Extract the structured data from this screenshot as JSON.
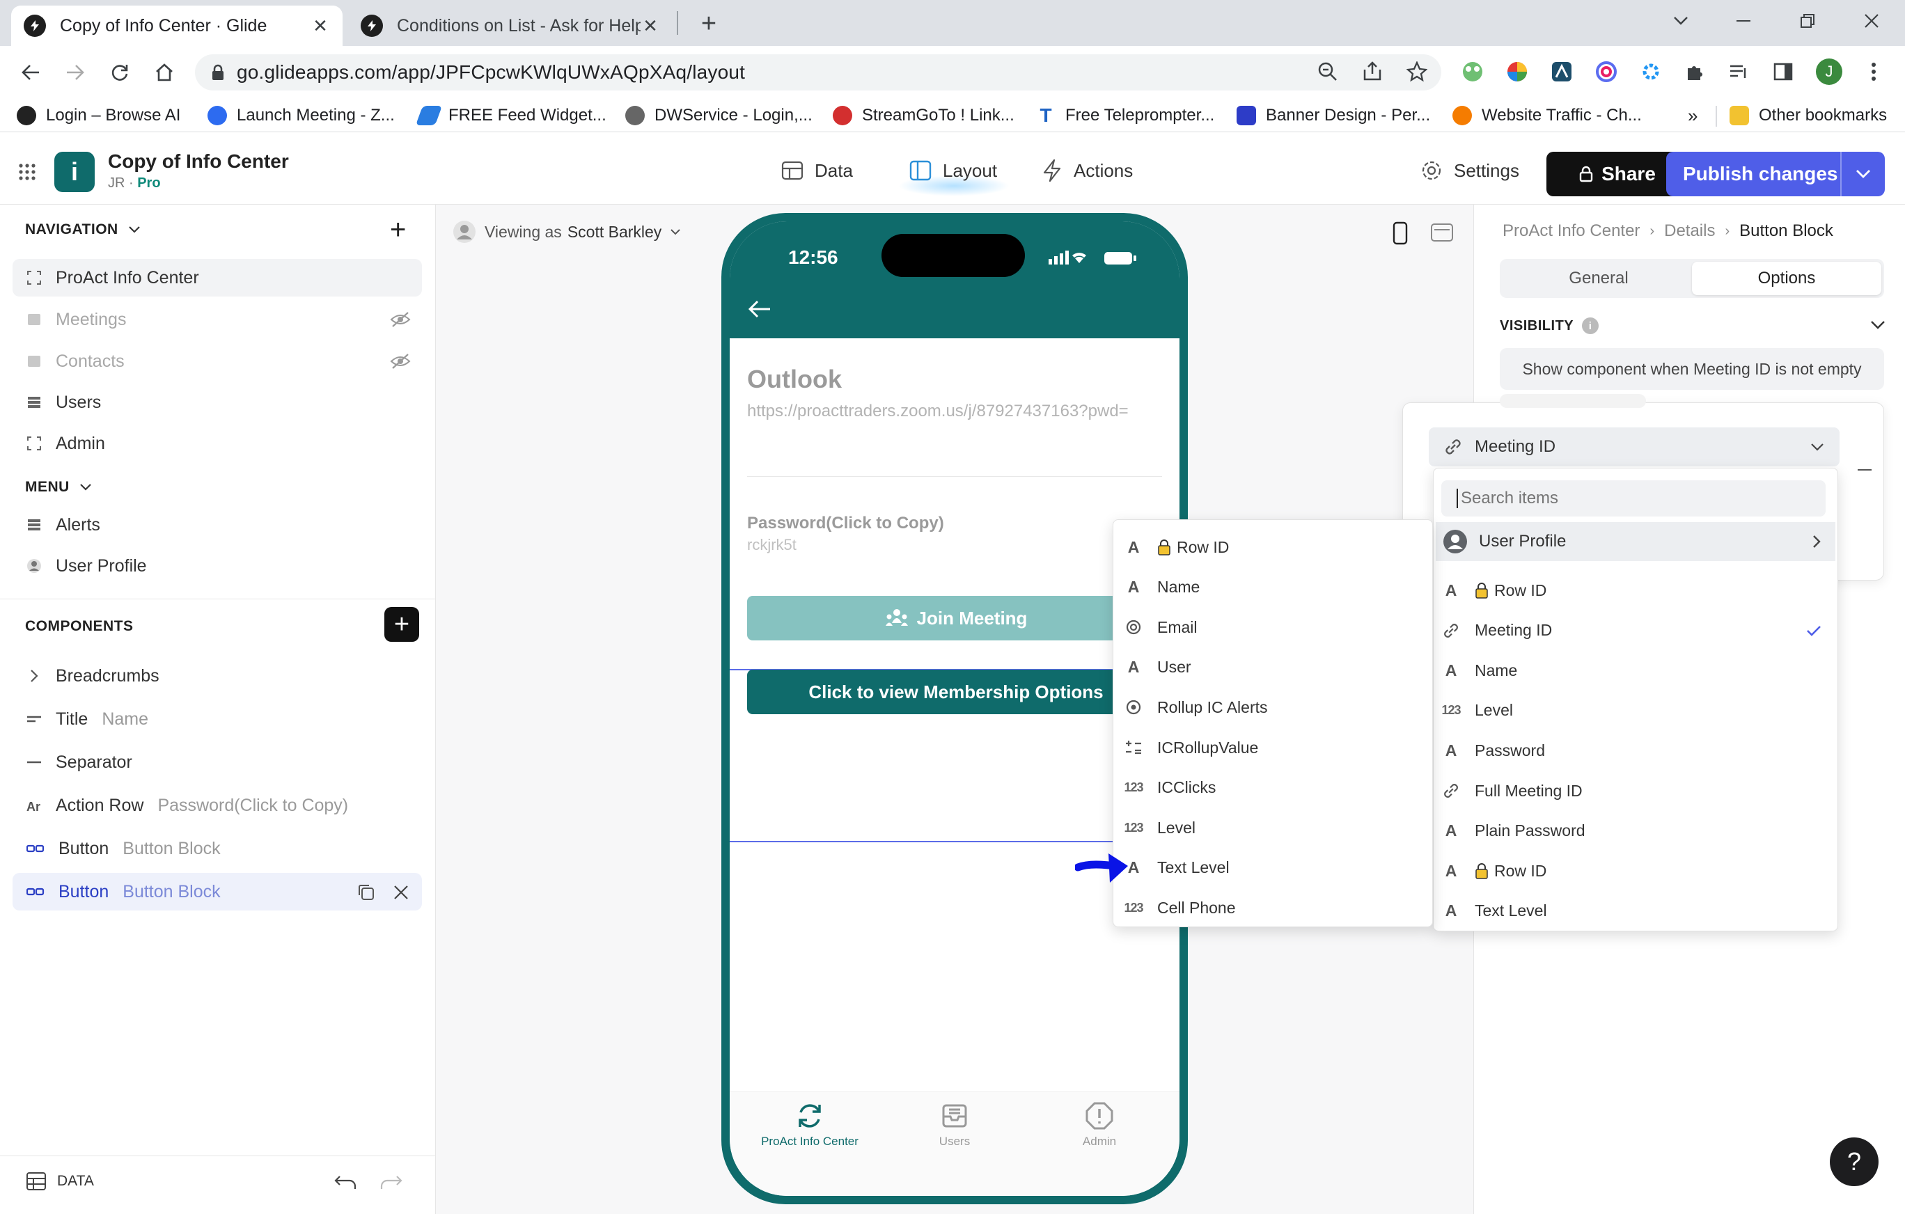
{
  "browser": {
    "tabs": [
      {
        "title": "Copy of Info Center · Glide"
      },
      {
        "title": "Conditions on List - Ask for Help"
      }
    ],
    "url": "go.glideapps.com/app/JPFCpcwKWlqUWxAQpXAq/layout",
    "profile_initial": "J",
    "bookmarks": [
      "Login – Browse AI",
      "Launch Meeting - Z...",
      "FREE Feed Widget...",
      "DWService - Login,...",
      "StreamGoTo ! Link...",
      "Free Teleprompter...",
      "Banner Design - Per...",
      "Website Traffic - Ch...",
      "»",
      "Other bookmarks"
    ]
  },
  "app": {
    "name": "Copy of Info Center",
    "owner": "JR · ",
    "plan": "Pro",
    "logo_letter": "i",
    "tabs": [
      "Data",
      "Layout",
      "Actions"
    ],
    "settings_label": "Settings",
    "share_label": "Share",
    "publish_label": "Publish changes"
  },
  "sidebar": {
    "navigation_label": "NAVIGATION",
    "navigation_items": [
      {
        "label": "ProAct Info Center",
        "hidden": false
      },
      {
        "label": "Meetings",
        "hidden": true
      },
      {
        "label": "Contacts",
        "hidden": true
      },
      {
        "label": "Users",
        "hidden": false
      },
      {
        "label": "Admin",
        "hidden": false
      }
    ],
    "menu_label": "MENU",
    "menu_items": [
      {
        "label": "Alerts"
      },
      {
        "label": "User Profile"
      }
    ],
    "components_label": "COMPONENTS",
    "components": [
      {
        "label": "Breadcrumbs",
        "sub": ""
      },
      {
        "label": "Title",
        "sub": "Name"
      },
      {
        "label": "Separator",
        "sub": ""
      },
      {
        "label": "Action Row",
        "sub": "Password(Click to Copy)"
      },
      {
        "label": "Button",
        "sub": "Button Block"
      },
      {
        "label": "Button",
        "sub": "Button Block"
      }
    ],
    "data_label": "DATA"
  },
  "canvas": {
    "viewing_as_prefix": "Viewing as",
    "viewing_as_user": "Scott Barkley",
    "phone": {
      "time": "12:56",
      "title": "Outlook",
      "link": "https://proacttraders.zoom.us/j/87927437163?pwd=",
      "password_label": "Password(Click to Copy)",
      "password_value": "rckjrk5t",
      "join_label": "Join Meeting",
      "membership_label": "Click to view Membership Options",
      "tabs": [
        {
          "label": "ProAct Info Center",
          "active": true
        },
        {
          "label": "Users",
          "active": false
        },
        {
          "label": "Admin",
          "active": false
        }
      ]
    }
  },
  "right_panel": {
    "breadcrumb": [
      "ProAct Info Center",
      "Details",
      "Button Block"
    ],
    "tabs": [
      "General",
      "Options"
    ],
    "active_tab": "Options",
    "visibility_label": "VISIBILITY",
    "condition_summary": "Show component when Meeting ID is not empty",
    "selected_column": "Meeting ID",
    "search_placeholder": "Search items"
  },
  "column_menu": {
    "items": [
      {
        "icon": "A",
        "label": "Row ID",
        "locked": true
      },
      {
        "icon": "A",
        "label": "Name",
        "locked": false
      },
      {
        "icon": "@",
        "label": "Email",
        "locked": false
      },
      {
        "icon": "A",
        "label": "User",
        "locked": false
      },
      {
        "icon": "rollup",
        "label": "Rollup IC Alerts",
        "locked": false
      },
      {
        "icon": "math",
        "label": "ICRollupValue",
        "locked": false
      },
      {
        "icon": "123",
        "label": "ICClicks",
        "locked": false
      },
      {
        "icon": "123",
        "label": "Level",
        "locked": false
      },
      {
        "icon": "A",
        "label": "Text Level",
        "locked": false
      },
      {
        "icon": "123",
        "label": "Cell Phone",
        "locked": false
      }
    ]
  },
  "field_menu": {
    "group_label": "User Profile",
    "items": [
      {
        "icon": "A",
        "label": "Row ID",
        "locked": true,
        "checked": false
      },
      {
        "icon": "link",
        "label": "Meeting ID",
        "locked": false,
        "checked": true
      },
      {
        "icon": "A",
        "label": "Name",
        "locked": false,
        "checked": false
      },
      {
        "icon": "123",
        "label": "Level",
        "locked": false,
        "checked": false
      },
      {
        "icon": "A",
        "label": "Password",
        "locked": false,
        "checked": false
      },
      {
        "icon": "link",
        "label": "Full Meeting ID",
        "locked": false,
        "checked": false
      },
      {
        "icon": "A",
        "label": "Plain Password",
        "locked": false,
        "checked": false
      },
      {
        "icon": "A",
        "label": "Row ID",
        "locked": true,
        "checked": false
      },
      {
        "icon": "A",
        "label": "Text Level",
        "locked": false,
        "checked": false
      }
    ]
  },
  "colors": {
    "teal": "#0f6b6b",
    "publish": "#4f5ee8",
    "annotation_arrow": "#0a14e6",
    "check": "#4f5ee8"
  },
  "help_label": "?"
}
